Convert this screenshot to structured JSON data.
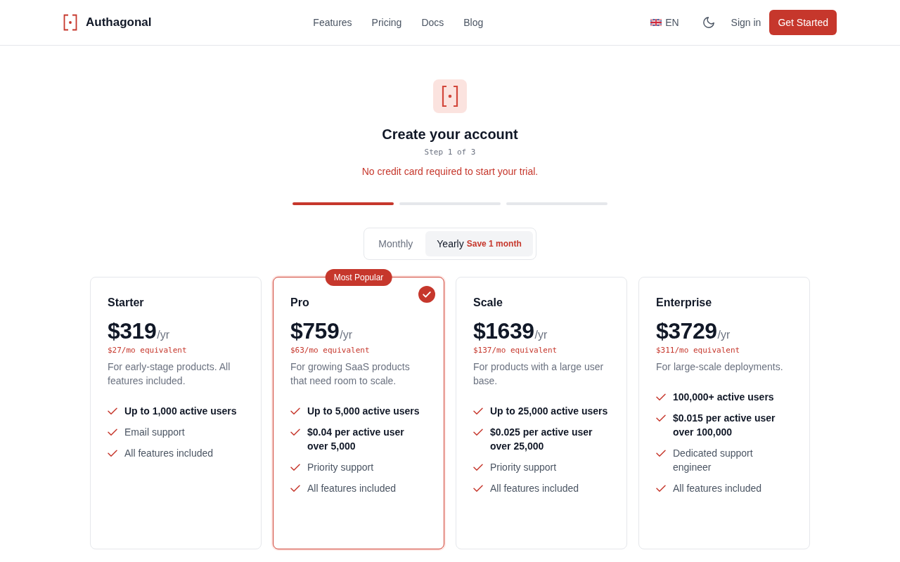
{
  "header": {
    "brand": "Authagonal",
    "nav_links": [
      "Features",
      "Pricing",
      "Docs",
      "Blog"
    ],
    "language": "EN",
    "sign_in": "Sign in",
    "cta": "Get Started"
  },
  "signup": {
    "title": "Create your account",
    "step": "Step 1 of 3",
    "note": "No credit card required to start your trial.",
    "progress": [
      {
        "done": true
      },
      {
        "done": false
      },
      {
        "done": false
      }
    ]
  },
  "billing_toggle": [
    {
      "label": "Monthly",
      "selected": false
    },
    {
      "label": "Yearly",
      "selected": true,
      "badge": "Save 1 month"
    }
  ],
  "plans": [
    {
      "name": "Starter",
      "price": "$319",
      "period": "/yr",
      "monthly_equivalent": "$27/mo equivalent",
      "description": "For early-stage products. All features included.",
      "selected": false,
      "features": [
        {
          "text": "Up to 1,000 active users",
          "emphasized": true
        },
        {
          "text": "Email support",
          "emphasized": false
        },
        {
          "text": "All features included",
          "emphasized": false
        }
      ]
    },
    {
      "name": "Pro",
      "badge": "Most Popular",
      "price": "$759",
      "period": "/yr",
      "monthly_equivalent": "$63/mo equivalent",
      "description": "For growing SaaS products that need room to scale.",
      "selected": true,
      "features": [
        {
          "text": "Up to 5,000 active users",
          "emphasized": true
        },
        {
          "text": "$0.04 per active user over 5,000",
          "emphasized": true
        },
        {
          "text": "Priority support",
          "emphasized": false
        },
        {
          "text": "All features included",
          "emphasized": false
        }
      ]
    },
    {
      "name": "Scale",
      "price": "$1639",
      "period": "/yr",
      "monthly_equivalent": "$137/mo equivalent",
      "description": "For products with a large user base.",
      "selected": false,
      "features": [
        {
          "text": "Up to 25,000 active users",
          "emphasized": true
        },
        {
          "text": "$0.025 per active user over 25,000",
          "emphasized": true
        },
        {
          "text": "Priority support",
          "emphasized": false
        },
        {
          "text": "All features included",
          "emphasized": false
        }
      ]
    },
    {
      "name": "Enterprise",
      "price": "$3729",
      "period": "/yr",
      "monthly_equivalent": "$311/mo equivalent",
      "description": "For large-scale deployments.",
      "selected": false,
      "features": [
        {
          "text": "100,000+ active users",
          "emphasized": true
        },
        {
          "text": "$0.015 per active user over 100,000",
          "emphasized": true
        },
        {
          "text": "Dedicated support engineer",
          "emphasized": false
        },
        {
          "text": "All features included",
          "emphasized": false
        }
      ]
    }
  ]
}
